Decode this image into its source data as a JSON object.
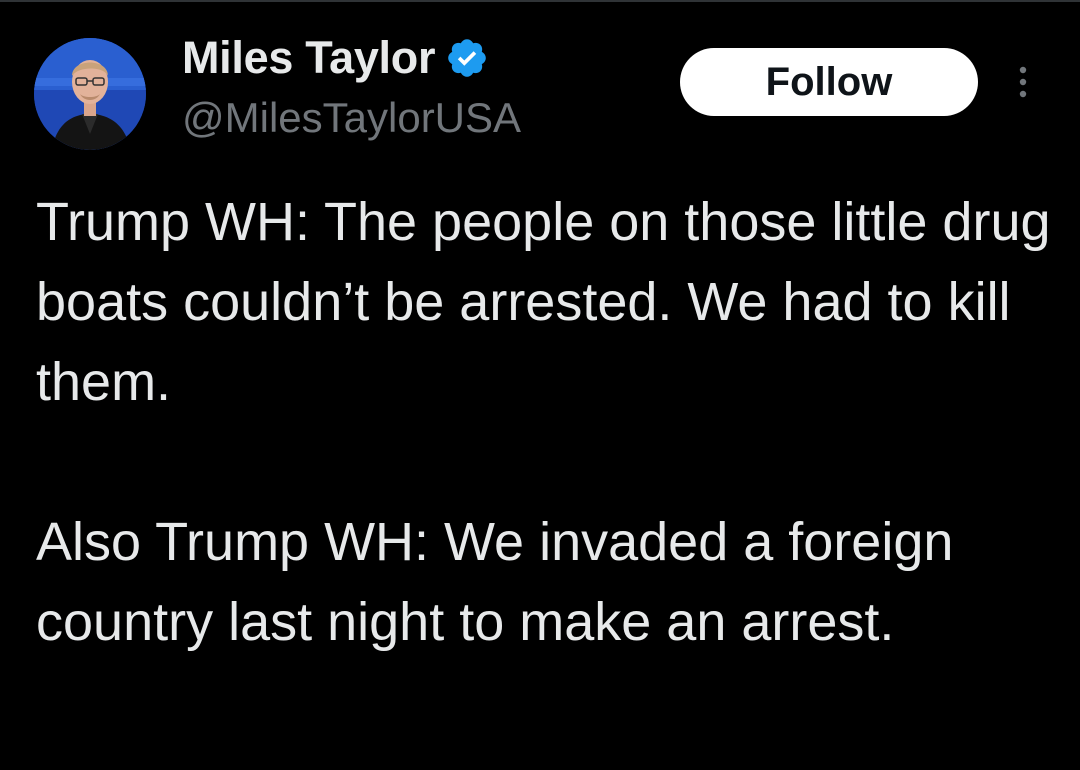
{
  "author": {
    "display_name": "Miles Taylor",
    "handle": "@MilesTaylorUSA",
    "verified": true,
    "verified_badge_color": "#1d9bf0"
  },
  "actions": {
    "follow_label": "Follow",
    "more_icon": "more-vertical-icon"
  },
  "tweet": {
    "paragraphs": [
      "Trump WH: The people on those little drug boats couldn’t be arrested. We had to kill them.",
      "Also Trump WH: We invaded a foreign country last night to make an arrest."
    ]
  },
  "colors": {
    "background": "#000000",
    "text_primary": "#e7e9ea",
    "text_secondary": "#71767b",
    "button_bg": "#ffffff",
    "button_text": "#0f1419"
  }
}
